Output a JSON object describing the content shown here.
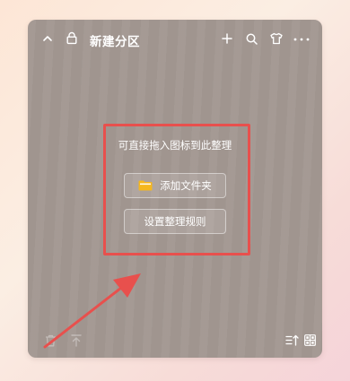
{
  "panel": {
    "title": "新建分区",
    "hint": "可直接拖入图标到此整理",
    "add_folder_label": "添加文件夹",
    "rules_label": "设置整理规则"
  },
  "icons": {
    "header": [
      "chevron-up-icon",
      "lock-icon",
      "plus-icon",
      "search-icon",
      "shirt-icon",
      "more-icon"
    ],
    "footer": [
      "trash-icon",
      "pin-top-icon",
      "sort-icon",
      "grid-view-icon"
    ],
    "button": "folder-icon"
  },
  "colors": {
    "panel_background": "#a39892",
    "highlight_border": "#e8504d",
    "arrow": "#e8504d",
    "folder": "#f5b71e"
  }
}
